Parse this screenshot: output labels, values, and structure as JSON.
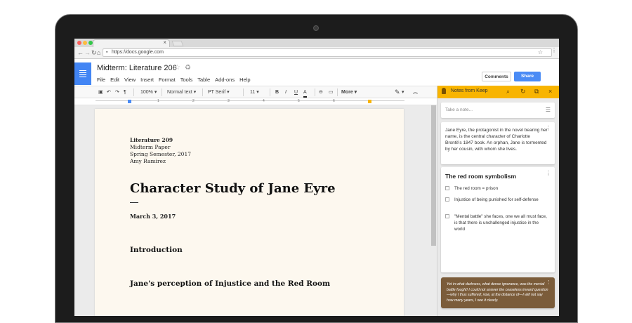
{
  "browser": {
    "tab_close": "×",
    "url": "https://docs.google.com",
    "colors": {
      "dot_red": "#fc605c",
      "dot_yellow": "#fdbc40",
      "dot_green": "#34c84a"
    }
  },
  "doc": {
    "title": "Midterm: Literature 206",
    "menu": [
      "File",
      "Edit",
      "View",
      "Insert",
      "Format",
      "Tools",
      "Table",
      "Add-ons",
      "Help"
    ],
    "comments_label": "Comments",
    "share_label": "Share",
    "toolbar": {
      "zoom": "100%",
      "style": "Normal text",
      "font": "PT Serif",
      "size": "11",
      "bold": "B",
      "italic": "I",
      "underline": "U",
      "text_color": "A",
      "more": "More"
    },
    "ruler_numbers": [
      "1",
      "2",
      "3",
      "4",
      "5",
      "6"
    ],
    "header_lines": [
      "Literature 209",
      "Midterm Paper",
      "Spring Semester, 2017",
      "Amy Ramirez"
    ],
    "heading": "Character Study of Jane Eyre",
    "date": "March 3, 2017",
    "sections": [
      "Introduction",
      "Jane's perception of Injustice and the Red Room"
    ]
  },
  "keep": {
    "title": "Notes from Keep",
    "placeholder": "Take a note...",
    "note1": "Jane Eyre, the protagonist in the novel bearing her name, is the central character of Charlotte Brontë's 1847 book. An orphan, Jane is tormented by her cousin, with whom she lives.",
    "note2": {
      "heading": "The red room symbolism",
      "items": [
        "The red room = prison",
        "Injustice of being punished for self-defense",
        "\"Mental battle\" she faces, one we all must face, is that there is unchallenged injustice in the world"
      ]
    },
    "note3": "Yet in what darkness, what dense ignorance, was the mental battle fought! I could not answer the ceaseless inward question—why I thus suffered; now, at the distance of—I will not say how many years, I see it clearly.",
    "colors": {
      "header": "#f8b400",
      "quote_card": "#7b5c3a"
    }
  }
}
